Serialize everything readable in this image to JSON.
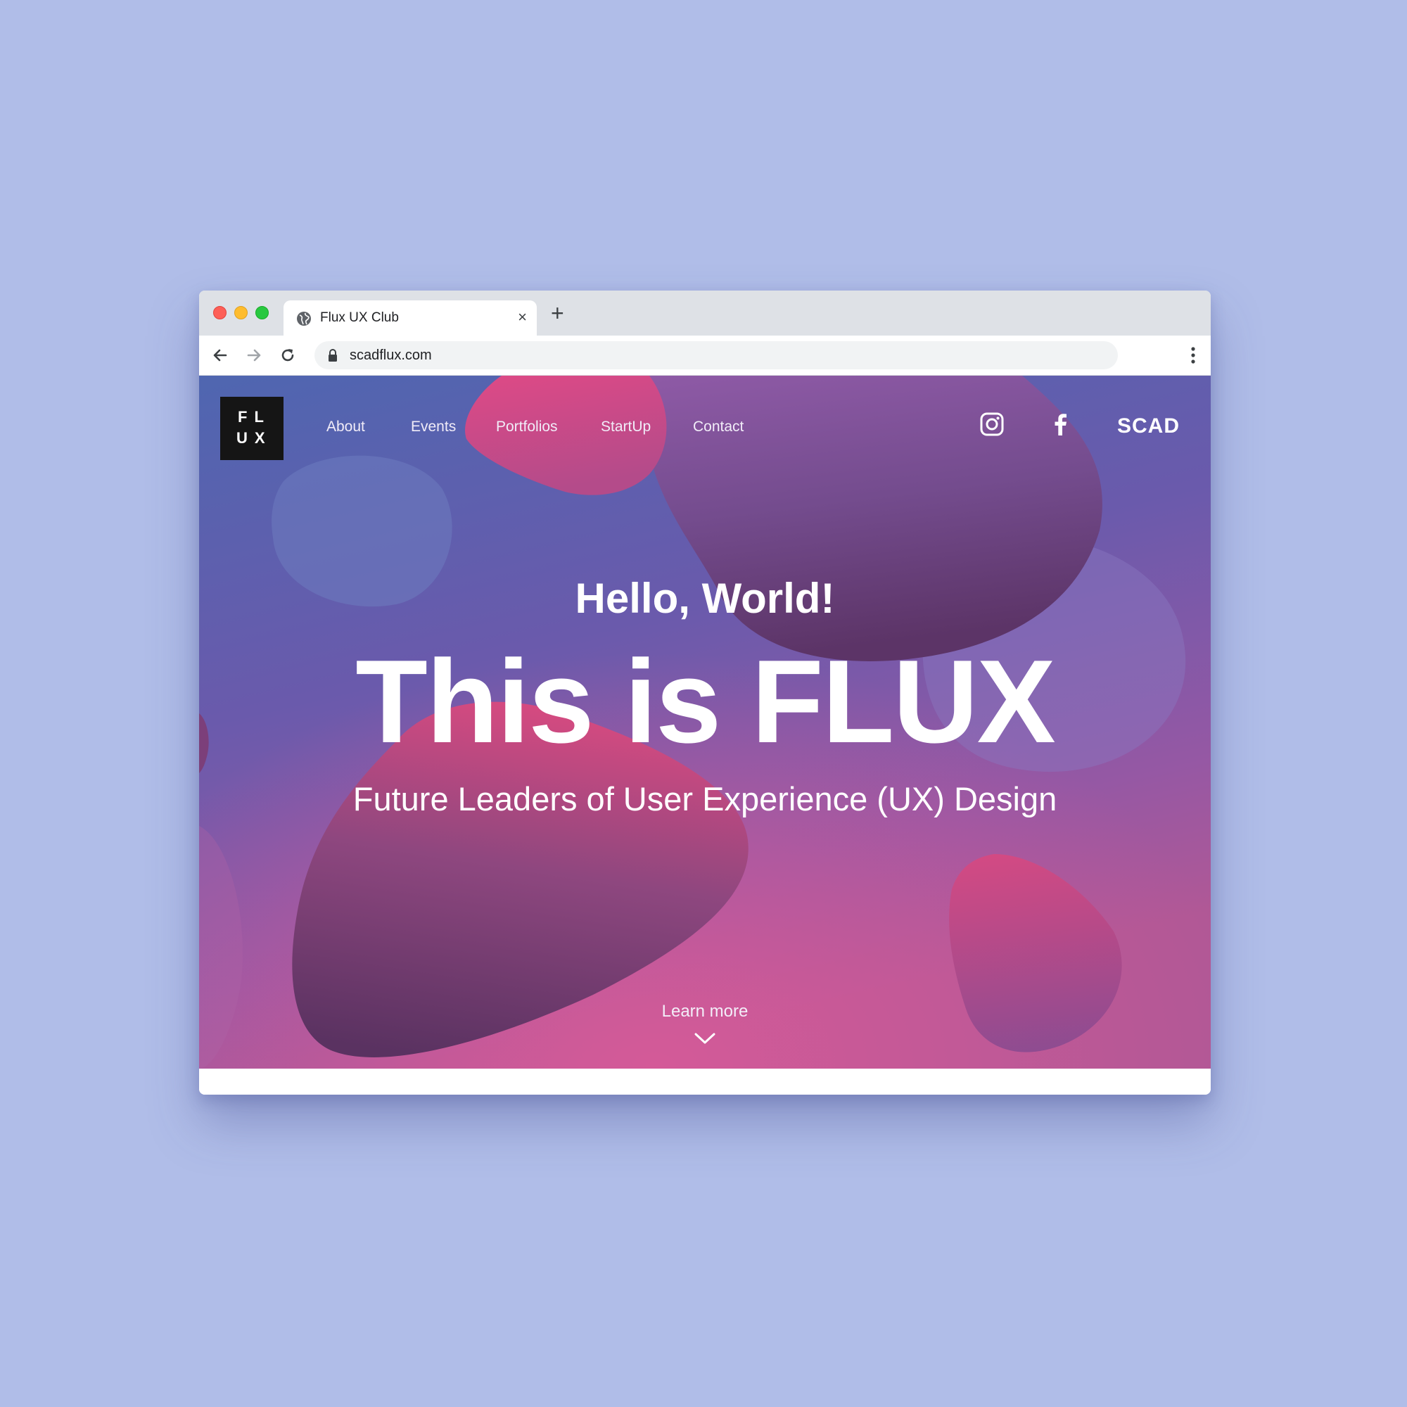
{
  "browser": {
    "tab_title": "Flux UX Club",
    "tab_close": "×",
    "new_tab": "+",
    "url": "scadflux.com"
  },
  "site": {
    "logo": {
      "line1": "FL",
      "line2": "UX"
    },
    "nav": [
      {
        "label": "About"
      },
      {
        "label": "Events"
      },
      {
        "label": "Portfolios"
      },
      {
        "label": "StartUp"
      },
      {
        "label": "Contact"
      }
    ],
    "social": [
      "instagram-icon",
      "facebook-icon"
    ],
    "scad_label": "SCAD"
  },
  "hero": {
    "greeting": "Hello, World!",
    "headline": "This is FLUX",
    "subtitle": "Future Leaders of User Experience (UX) Design",
    "learn_more": "Learn more"
  },
  "colors": {
    "page_background": "#b0bde8",
    "hero_blue": "#5465ae",
    "hero_purple": "#8a55a0",
    "blob_pink": "#d4437e",
    "blob_plum": "#5e3264",
    "logo_bg": "#151515"
  }
}
